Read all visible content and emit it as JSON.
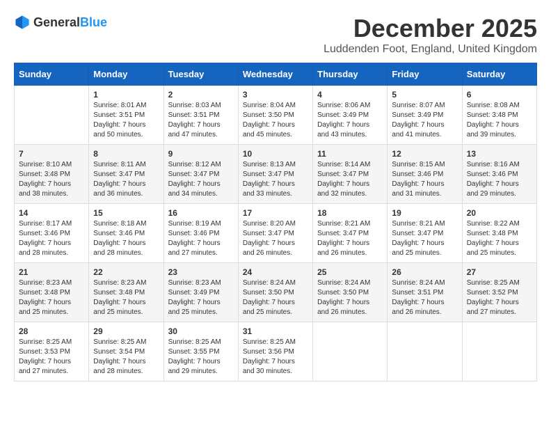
{
  "logo": {
    "general": "General",
    "blue": "Blue"
  },
  "title": "December 2025",
  "location": "Luddenden Foot, England, United Kingdom",
  "days_of_week": [
    "Sunday",
    "Monday",
    "Tuesday",
    "Wednesday",
    "Thursday",
    "Friday",
    "Saturday"
  ],
  "weeks": [
    [
      {
        "day": "",
        "sunrise": "",
        "sunset": "",
        "daylight": ""
      },
      {
        "day": "1",
        "sunrise": "Sunrise: 8:01 AM",
        "sunset": "Sunset: 3:51 PM",
        "daylight": "Daylight: 7 hours and 50 minutes."
      },
      {
        "day": "2",
        "sunrise": "Sunrise: 8:03 AM",
        "sunset": "Sunset: 3:51 PM",
        "daylight": "Daylight: 7 hours and 47 minutes."
      },
      {
        "day": "3",
        "sunrise": "Sunrise: 8:04 AM",
        "sunset": "Sunset: 3:50 PM",
        "daylight": "Daylight: 7 hours and 45 minutes."
      },
      {
        "day": "4",
        "sunrise": "Sunrise: 8:06 AM",
        "sunset": "Sunset: 3:49 PM",
        "daylight": "Daylight: 7 hours and 43 minutes."
      },
      {
        "day": "5",
        "sunrise": "Sunrise: 8:07 AM",
        "sunset": "Sunset: 3:49 PM",
        "daylight": "Daylight: 7 hours and 41 minutes."
      },
      {
        "day": "6",
        "sunrise": "Sunrise: 8:08 AM",
        "sunset": "Sunset: 3:48 PM",
        "daylight": "Daylight: 7 hours and 39 minutes."
      }
    ],
    [
      {
        "day": "7",
        "sunrise": "Sunrise: 8:10 AM",
        "sunset": "Sunset: 3:48 PM",
        "daylight": "Daylight: 7 hours and 38 minutes."
      },
      {
        "day": "8",
        "sunrise": "Sunrise: 8:11 AM",
        "sunset": "Sunset: 3:47 PM",
        "daylight": "Daylight: 7 hours and 36 minutes."
      },
      {
        "day": "9",
        "sunrise": "Sunrise: 8:12 AM",
        "sunset": "Sunset: 3:47 PM",
        "daylight": "Daylight: 7 hours and 34 minutes."
      },
      {
        "day": "10",
        "sunrise": "Sunrise: 8:13 AM",
        "sunset": "Sunset: 3:47 PM",
        "daylight": "Daylight: 7 hours and 33 minutes."
      },
      {
        "day": "11",
        "sunrise": "Sunrise: 8:14 AM",
        "sunset": "Sunset: 3:47 PM",
        "daylight": "Daylight: 7 hours and 32 minutes."
      },
      {
        "day": "12",
        "sunrise": "Sunrise: 8:15 AM",
        "sunset": "Sunset: 3:46 PM",
        "daylight": "Daylight: 7 hours and 31 minutes."
      },
      {
        "day": "13",
        "sunrise": "Sunrise: 8:16 AM",
        "sunset": "Sunset: 3:46 PM",
        "daylight": "Daylight: 7 hours and 29 minutes."
      }
    ],
    [
      {
        "day": "14",
        "sunrise": "Sunrise: 8:17 AM",
        "sunset": "Sunset: 3:46 PM",
        "daylight": "Daylight: 7 hours and 28 minutes."
      },
      {
        "day": "15",
        "sunrise": "Sunrise: 8:18 AM",
        "sunset": "Sunset: 3:46 PM",
        "daylight": "Daylight: 7 hours and 28 minutes."
      },
      {
        "day": "16",
        "sunrise": "Sunrise: 8:19 AM",
        "sunset": "Sunset: 3:46 PM",
        "daylight": "Daylight: 7 hours and 27 minutes."
      },
      {
        "day": "17",
        "sunrise": "Sunrise: 8:20 AM",
        "sunset": "Sunset: 3:47 PM",
        "daylight": "Daylight: 7 hours and 26 minutes."
      },
      {
        "day": "18",
        "sunrise": "Sunrise: 8:21 AM",
        "sunset": "Sunset: 3:47 PM",
        "daylight": "Daylight: 7 hours and 26 minutes."
      },
      {
        "day": "19",
        "sunrise": "Sunrise: 8:21 AM",
        "sunset": "Sunset: 3:47 PM",
        "daylight": "Daylight: 7 hours and 25 minutes."
      },
      {
        "day": "20",
        "sunrise": "Sunrise: 8:22 AM",
        "sunset": "Sunset: 3:48 PM",
        "daylight": "Daylight: 7 hours and 25 minutes."
      }
    ],
    [
      {
        "day": "21",
        "sunrise": "Sunrise: 8:23 AM",
        "sunset": "Sunset: 3:48 PM",
        "daylight": "Daylight: 7 hours and 25 minutes."
      },
      {
        "day": "22",
        "sunrise": "Sunrise: 8:23 AM",
        "sunset": "Sunset: 3:48 PM",
        "daylight": "Daylight: 7 hours and 25 minutes."
      },
      {
        "day": "23",
        "sunrise": "Sunrise: 8:23 AM",
        "sunset": "Sunset: 3:49 PM",
        "daylight": "Daylight: 7 hours and 25 minutes."
      },
      {
        "day": "24",
        "sunrise": "Sunrise: 8:24 AM",
        "sunset": "Sunset: 3:50 PM",
        "daylight": "Daylight: 7 hours and 25 minutes."
      },
      {
        "day": "25",
        "sunrise": "Sunrise: 8:24 AM",
        "sunset": "Sunset: 3:50 PM",
        "daylight": "Daylight: 7 hours and 26 minutes."
      },
      {
        "day": "26",
        "sunrise": "Sunrise: 8:24 AM",
        "sunset": "Sunset: 3:51 PM",
        "daylight": "Daylight: 7 hours and 26 minutes."
      },
      {
        "day": "27",
        "sunrise": "Sunrise: 8:25 AM",
        "sunset": "Sunset: 3:52 PM",
        "daylight": "Daylight: 7 hours and 27 minutes."
      }
    ],
    [
      {
        "day": "28",
        "sunrise": "Sunrise: 8:25 AM",
        "sunset": "Sunset: 3:53 PM",
        "daylight": "Daylight: 7 hours and 27 minutes."
      },
      {
        "day": "29",
        "sunrise": "Sunrise: 8:25 AM",
        "sunset": "Sunset: 3:54 PM",
        "daylight": "Daylight: 7 hours and 28 minutes."
      },
      {
        "day": "30",
        "sunrise": "Sunrise: 8:25 AM",
        "sunset": "Sunset: 3:55 PM",
        "daylight": "Daylight: 7 hours and 29 minutes."
      },
      {
        "day": "31",
        "sunrise": "Sunrise: 8:25 AM",
        "sunset": "Sunset: 3:56 PM",
        "daylight": "Daylight: 7 hours and 30 minutes."
      },
      {
        "day": "",
        "sunrise": "",
        "sunset": "",
        "daylight": ""
      },
      {
        "day": "",
        "sunrise": "",
        "sunset": "",
        "daylight": ""
      },
      {
        "day": "",
        "sunrise": "",
        "sunset": "",
        "daylight": ""
      }
    ]
  ]
}
